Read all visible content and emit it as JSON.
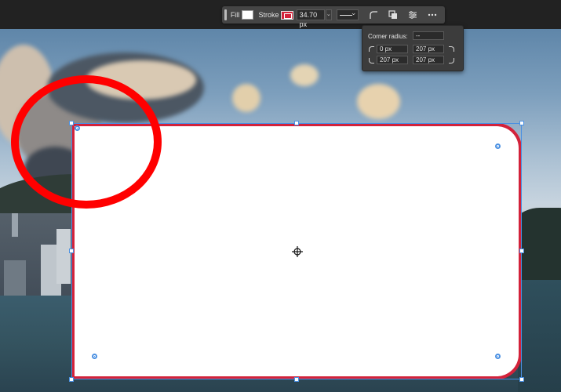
{
  "toolbar": {
    "fill_label": "Fill",
    "stroke_label": "Stroke",
    "stroke_size": "34.70 px",
    "fill_color": "#ffffff",
    "stroke_color": "#d3223a",
    "icons": [
      "corner-radius-icon",
      "path-operations-icon",
      "align-settings-icon",
      "more-icon"
    ]
  },
  "corner_radius": {
    "label": "Corner radius:",
    "all_value": "--",
    "top_left": "0 px",
    "top_right": "207 px",
    "bottom_left": "207 px",
    "bottom_right": "207 px"
  },
  "canvas": {
    "shape_fill": "#ffffff",
    "shape_stroke": "#d3223a",
    "selection_color": "#4a90e2",
    "annotation_color": "#ff0000"
  }
}
